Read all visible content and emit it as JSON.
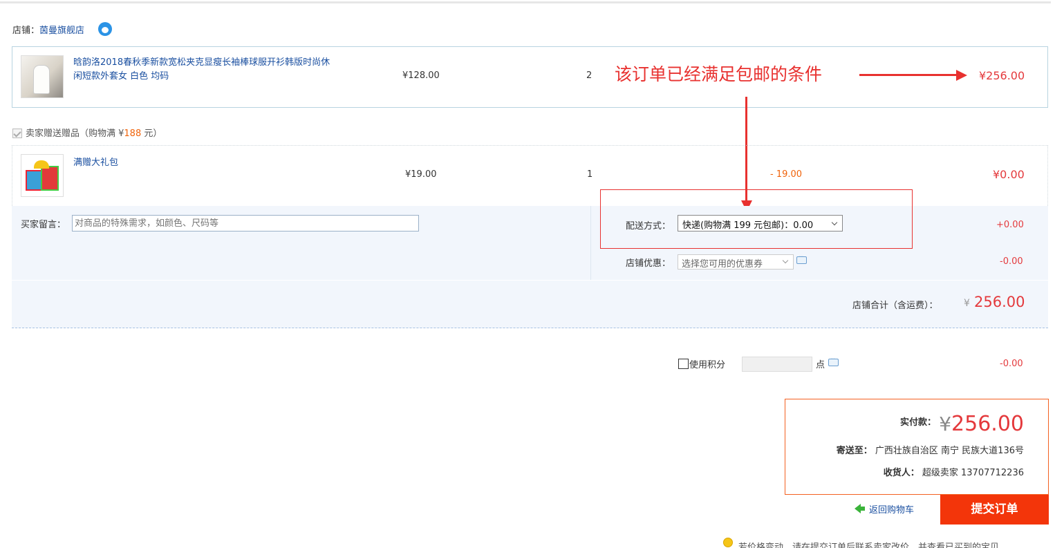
{
  "shop": {
    "label": "店铺：",
    "name": "茵曼旗舰店"
  },
  "item": {
    "title": "晗韵洛2018春秋季新款宽松夹克显瘦长袖棒球服开衫韩版时尚休闲短款外套女 白色 均码",
    "unit_price": "¥128.00",
    "quantity": "2",
    "total": "¥256.00"
  },
  "annotation": {
    "text": "该订单已经满足包邮的条件"
  },
  "gift_section": {
    "label_prefix": "卖家赠送赠品（购物满 ¥",
    "threshold": "188",
    "label_suffix": " 元）"
  },
  "gift_item": {
    "title": "满赠大礼包",
    "unit_price": "¥19.00",
    "quantity": "1",
    "discount": "- 19.00",
    "total": "¥0.00"
  },
  "buyer_message": {
    "label": "买家留言：",
    "placeholder": "对商品的特殊需求，如颜色、尺码等"
  },
  "shipping": {
    "label": "配送方式：",
    "selected": "快递(购物满 199 元包邮)：0.00",
    "amount": "+0.00"
  },
  "coupon": {
    "label": "店铺优惠：",
    "selected": "选择您可用的优惠券",
    "amount": "-0.00"
  },
  "shop_total": {
    "label": "店铺合计（含运费）：",
    "currency": "¥",
    "value": "256.00"
  },
  "points": {
    "label": "使用积分",
    "unit": "点",
    "amount": "-0.00"
  },
  "payment": {
    "label": "实付款：",
    "currency": "¥",
    "value": "256.00",
    "address_label": "寄送至：",
    "address": "广西壮族自治区 南宁 民族大道136号",
    "receiver_label": "收货人：",
    "receiver": "超级卖家 13707712236"
  },
  "actions": {
    "back_label": "返回购物车",
    "submit_label": "提交订单"
  },
  "notice": {
    "text": "若价格变动，请在提交订单后联系卖家改价，并查看已买到的宝贝"
  },
  "colors": {
    "accent_red": "#e4393c",
    "submit_orange": "#f3350a",
    "link_blue": "#1a4fa0",
    "annotation_red": "#e8312f"
  }
}
